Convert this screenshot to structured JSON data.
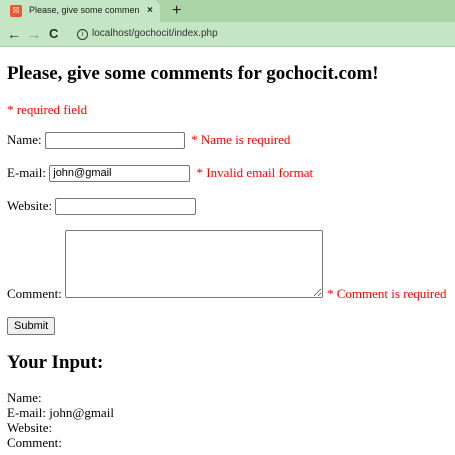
{
  "browser": {
    "tab_title": "Please, give some comments for",
    "tab_close": "×",
    "new_tab": "+",
    "favicon": "☒",
    "back": "←",
    "forward": "→",
    "reload": "C",
    "info": "i",
    "url": "localhost/gochocit/index.php"
  },
  "page": {
    "title": "Please, give some comments for gochocit.com!",
    "required_note": "* required field",
    "form": {
      "name_label": "Name:",
      "name_value": "",
      "name_error": "* Name is required",
      "email_label": "E-mail:",
      "email_value": "john@gmail",
      "email_error": "* Invalid email format",
      "website_label": "Website:",
      "website_value": "",
      "comment_label": "Comment:",
      "comment_value": "",
      "comment_error": "* Comment is required",
      "submit_label": "Submit"
    },
    "output": {
      "heading": "Your Input:",
      "name_line": "Name:",
      "email_line": "E-mail: john@gmail",
      "website_line": "Website:",
      "comment_line": "Comment:"
    }
  },
  "colors": {
    "chrome": "#c5e6c4",
    "error": "#ff0000",
    "favicon": "#e9572b"
  }
}
